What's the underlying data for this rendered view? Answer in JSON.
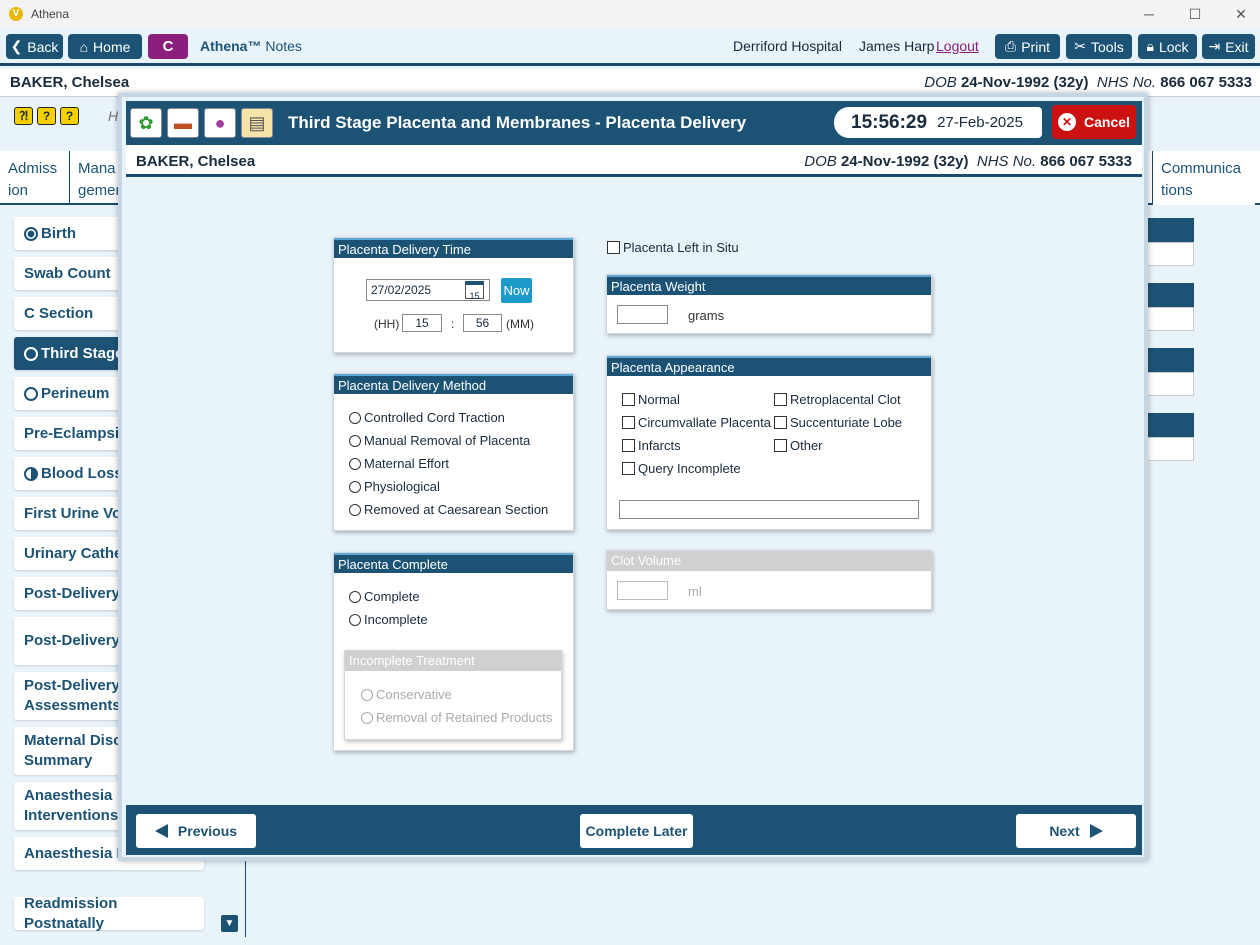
{
  "window": {
    "title": "Athena",
    "logo_letter": "V"
  },
  "toolbar": {
    "back": "Back",
    "home": "Home",
    "c_button": "C",
    "app_brand": "Athena™",
    "app_section": "Notes",
    "hospital": "Derriford Hospital",
    "user": "James Harp",
    "logout": "Logout",
    "print": "Print",
    "tools": "Tools",
    "lock": "Lock",
    "exit": "Exit"
  },
  "patient": {
    "name": "BAKER, Chelsea",
    "dob_label": "DOB",
    "dob": "24-Nov-1992 (32y)",
    "nhs_label": "NHS No.",
    "nhs": "866 067 5333"
  },
  "background": {
    "h_letter": "H",
    "tabs": [
      "Admiss ion",
      "Mana gement"
    ],
    "communications_tab": "Communica tions",
    "sidebar": [
      {
        "label": "Birth",
        "marker": "filled"
      },
      {
        "label": "Swab Count",
        "marker": ""
      },
      {
        "label": "C Section",
        "marker": ""
      },
      {
        "label": "Third Stage",
        "marker": "empty",
        "active": true
      },
      {
        "label": "Perineum",
        "marker": "empty"
      },
      {
        "label": "Pre-Eclampsia",
        "marker": ""
      },
      {
        "label": "Blood Loss",
        "marker": "half"
      },
      {
        "label": "First Urine Voi",
        "marker": ""
      },
      {
        "label": "Urinary Cathe",
        "marker": ""
      },
      {
        "label": "Post-Delivery",
        "marker": ""
      },
      {
        "label": "Post-Delivery Notes",
        "marker": ""
      },
      {
        "label": "Post-Delivery Assessments",
        "marker": ""
      },
      {
        "label": "Maternal Disc Summary",
        "marker": ""
      },
      {
        "label": "Anaesthesia Interventions",
        "marker": ""
      },
      {
        "label": "Anaesthesia Fo",
        "marker": ""
      },
      {
        "label": "Readmission Postnatally",
        "marker": ""
      }
    ]
  },
  "modal": {
    "title": "Third Stage Placenta and Membranes - Placenta Delivery",
    "clock_time": "15:56:29",
    "clock_date": "27-Feb-2025",
    "cancel": "Cancel",
    "delivery_time": {
      "header": "Placenta Delivery Time",
      "date": "27/02/2025",
      "calendar_day": "15",
      "now": "Now",
      "hh_label": "(HH)",
      "hh": "15",
      "sep": ":",
      "mm": "56",
      "mm_label": "(MM)"
    },
    "delivery_method": {
      "header": "Placenta Delivery Method",
      "options": [
        "Controlled Cord Traction",
        "Manual Removal of Placenta",
        "Maternal Effort",
        "Physiological",
        "Removed at Caesarean Section"
      ]
    },
    "complete": {
      "header": "Placenta Complete",
      "options": [
        "Complete",
        "Incomplete"
      ],
      "incomplete_treatment": {
        "header": "Incomplete Treatment",
        "options": [
          "Conservative",
          "Removal of Retained Products"
        ]
      }
    },
    "left_in_situ": "Placenta Left in Situ",
    "weight": {
      "header": "Placenta Weight",
      "value": "",
      "unit": "grams"
    },
    "appearance": {
      "header": "Placenta Appearance",
      "left": [
        "Normal",
        "Circumvallate Placenta",
        "Infarcts",
        "Query Incomplete"
      ],
      "right": [
        "Retroplacental Clot",
        "Succenturiate Lobe",
        "Other"
      ],
      "other_text": ""
    },
    "clot": {
      "header": "Clot Volume",
      "value": "",
      "unit": "ml"
    },
    "footer": {
      "previous": "Previous",
      "complete_later": "Complete Later",
      "next": "Next"
    }
  }
}
